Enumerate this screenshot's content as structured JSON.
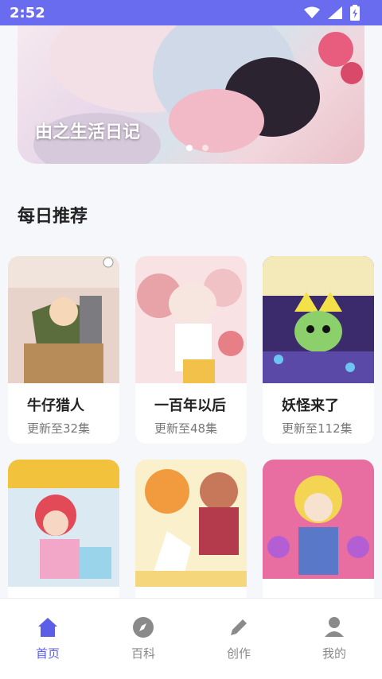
{
  "status_bar": {
    "time": "2:52"
  },
  "banner": {
    "title": "由之生活日记"
  },
  "section": {
    "title": "每日推荐"
  },
  "cards": [
    {
      "name": "牛仔猎人",
      "sub": "更新至32集"
    },
    {
      "name": "一百年以后",
      "sub": "更新至48集"
    },
    {
      "name": "妖怪来了",
      "sub": "更新至112集"
    },
    {
      "name": "",
      "sub": ""
    },
    {
      "name": "",
      "sub": ""
    },
    {
      "name": "",
      "sub": ""
    }
  ],
  "nav": [
    {
      "label": "首页",
      "icon": "home-icon",
      "active": true
    },
    {
      "label": "百科",
      "icon": "compass-icon",
      "active": false
    },
    {
      "label": "创作",
      "icon": "pencil-icon",
      "active": false
    },
    {
      "label": "我的",
      "icon": "user-icon",
      "active": false
    }
  ],
  "colors": {
    "accent": "#5b5ee6",
    "status_bar": "#6a6cf0",
    "background": "#f6f7fb"
  }
}
